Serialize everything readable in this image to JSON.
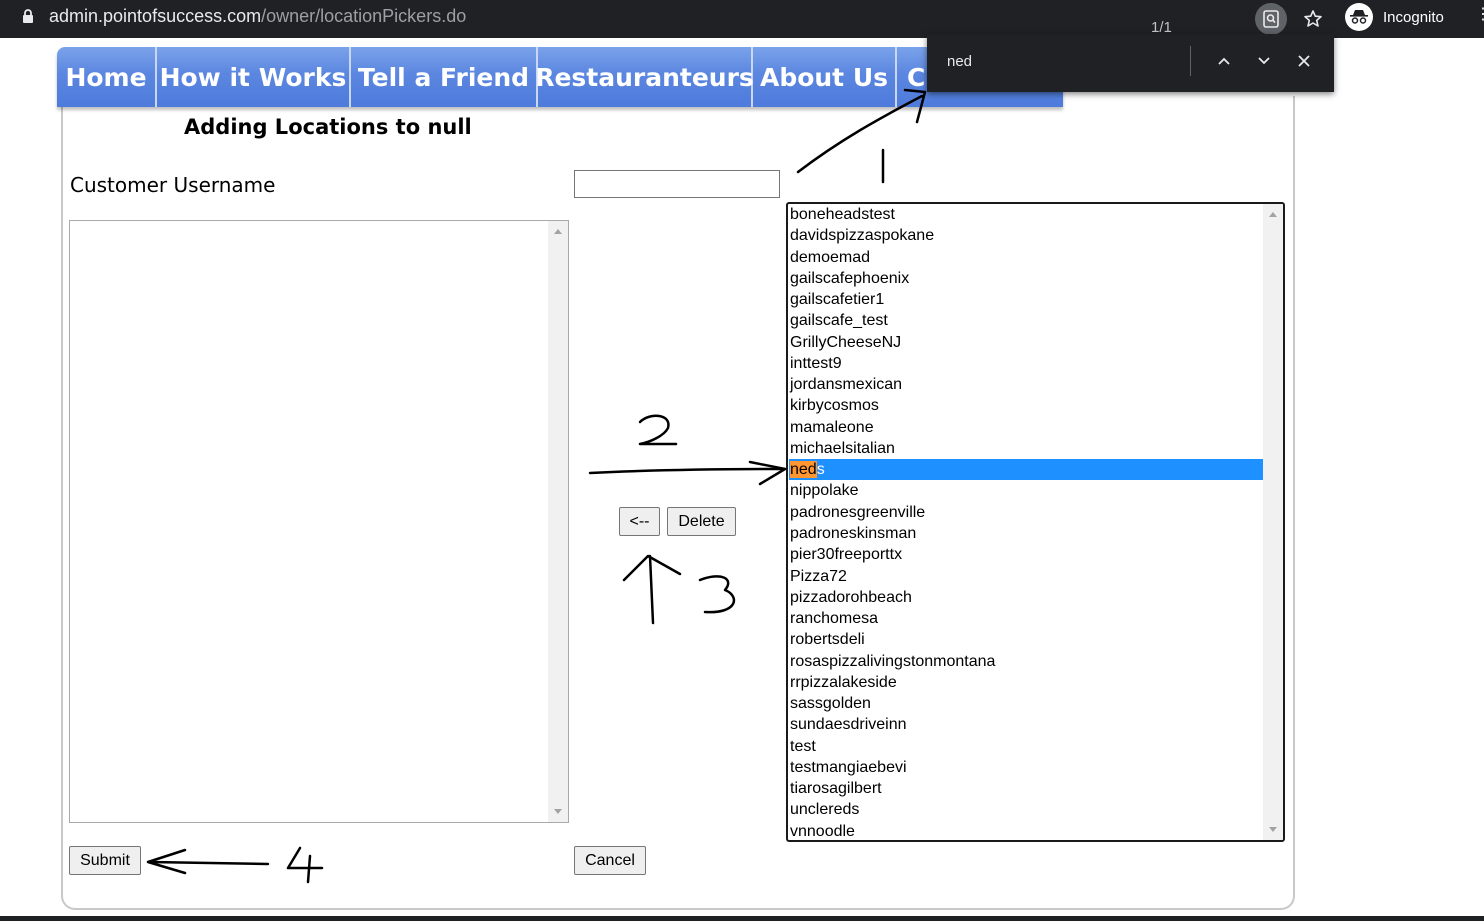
{
  "browser": {
    "url_host": "admin.pointofsuccess.com",
    "url_path": "/owner/locationPickers.do",
    "profile_label": "Incognito"
  },
  "find_bar": {
    "query": "ned",
    "count": "1/1"
  },
  "nav": {
    "items": [
      "Home",
      "How it Works",
      "Tell a Friend",
      "Restauranteurs",
      "About Us",
      "C"
    ]
  },
  "form": {
    "heading": "Adding Locations to null",
    "customer_label": "Customer Username",
    "username_value": "",
    "buttons": {
      "move_left": "<--",
      "delete": "Delete",
      "submit": "Submit",
      "cancel": "Cancel"
    },
    "available_locations": [
      "boneheadstest",
      "davidspizzaspokane",
      "demoemad",
      "gailscafephoenix",
      "gailscafetier1",
      "gailscafe_test",
      "GrillyCheeseNJ",
      "inttest9",
      "jordansmexican",
      "kirbycosmos",
      "mamaleone",
      "michaelsitalian",
      "neds",
      "nippolake",
      "padronesgreenville",
      "padroneskinsman",
      "pier30freeporttx",
      "Pizza72",
      "pizzadorohbeach",
      "ranchomesa",
      "robertsdeli",
      "rosaspizzalivingstonmontana",
      "rrpizzalakeside",
      "sassgolden",
      "sundaesdriveinn",
      "test",
      "testmangiaebevi",
      "tiarosagilbert",
      "unclereds",
      "vnnoodle"
    ],
    "selected_location": "neds",
    "selected_match": "ned",
    "selected_rest": "s"
  },
  "annotations": {
    "labels": [
      "1",
      "2",
      "3",
      "4"
    ]
  },
  "colors": {
    "nav_blue": "#5b86e0",
    "selection_blue": "#1e90ff",
    "find_highlight": "#ff9632",
    "chrome_dark": "#202124"
  }
}
